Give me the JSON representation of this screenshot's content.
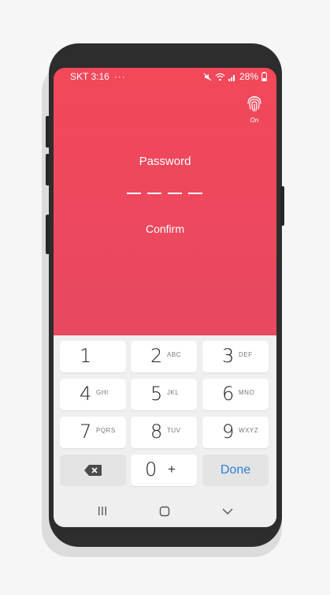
{
  "status": {
    "carrier_time": "SKT 3:16",
    "dots": "···",
    "battery": "28%"
  },
  "fingerprint": {
    "label": "On"
  },
  "password": {
    "title": "Password",
    "confirm": "Confirm",
    "entered_digits": 0,
    "total_digits": 4
  },
  "keypad": {
    "keys": [
      {
        "num": "1",
        "letters": ""
      },
      {
        "num": "2",
        "letters": "ABC"
      },
      {
        "num": "3",
        "letters": "DEF"
      },
      {
        "num": "4",
        "letters": "GHI"
      },
      {
        "num": "5",
        "letters": "JKL"
      },
      {
        "num": "6",
        "letters": "MNO"
      },
      {
        "num": "7",
        "letters": "PQRS"
      },
      {
        "num": "8",
        "letters": "TUV"
      },
      {
        "num": "9",
        "letters": "WXYZ"
      }
    ],
    "zero": "0",
    "plus": "+",
    "done": "Done"
  },
  "colors": {
    "gradient_top": "#f2485a",
    "gradient_bottom": "#df4a64",
    "done_blue": "#2f7fd6"
  },
  "icons": [
    "mute-icon",
    "wifi-icon",
    "signal-icon",
    "battery-icon",
    "fingerprint-icon",
    "backspace-icon",
    "recent-apps-icon",
    "home-icon",
    "back-icon"
  ]
}
